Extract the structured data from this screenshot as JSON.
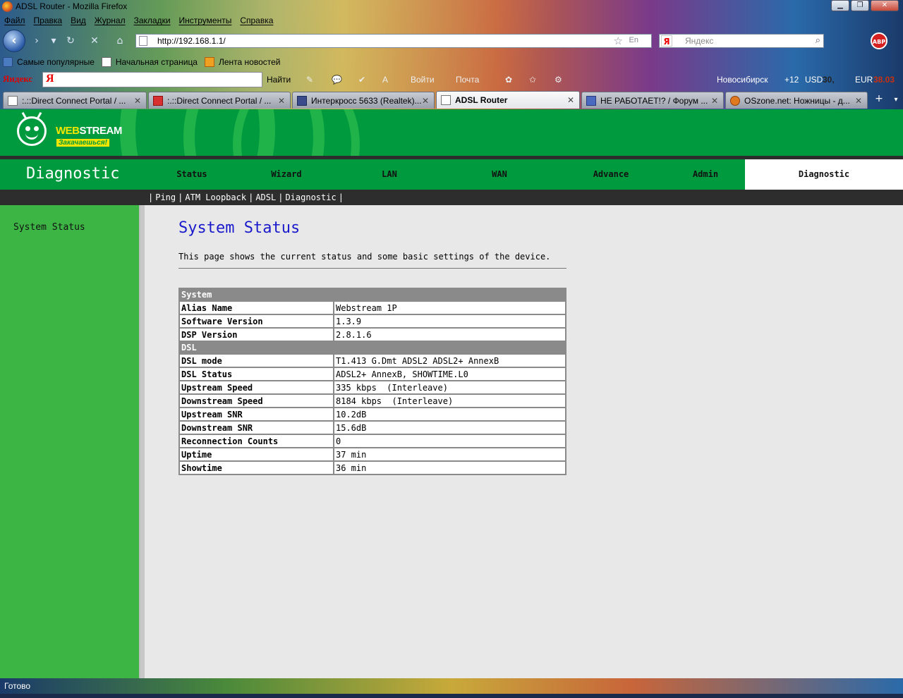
{
  "window": {
    "title": "ADSL Router - Mozilla Firefox"
  },
  "menubar": [
    "Файл",
    "Правка",
    "Вид",
    "Журнал",
    "Закладки",
    "Инструменты",
    "Справка"
  ],
  "navbar": {
    "url": "http://192.168.1.1/",
    "lang_indicator": "En",
    "search_placeholder": "Яндекс",
    "search_engine_letter": "Я",
    "abp_label": "ABP"
  },
  "bookmarks": [
    {
      "label": "Самые популярные",
      "icon": "popular-icon"
    },
    {
      "label": "Начальная страница",
      "icon": "page-icon"
    },
    {
      "label": "Лента новостей",
      "icon": "rss-icon"
    }
  ],
  "yandex_bar": {
    "logo": "Яндекс",
    "input_letter": "Я",
    "find_label": "Найти",
    "login_label": "Войти",
    "mail_label": "Почта",
    "city": "Новосибирск",
    "temperature": "+12",
    "usd_label": "USD",
    "usd_value": "30,",
    "eur_label": "EUR",
    "eur_value": "38.03"
  },
  "tabs": [
    {
      "label": ":.::Direct Connect Portal / ...",
      "icon": "page-icon",
      "active": false
    },
    {
      "label": ":.::Direct Connect Portal / ...",
      "icon": "dc-icon",
      "active": false
    },
    {
      "label": "Интеркросс 5633 (Realtek)...",
      "icon": "ik-icon",
      "active": false
    },
    {
      "label": "ADSL Router",
      "icon": "page-icon",
      "active": true
    },
    {
      "label": "НЕ РАБОТАЕТ!? / Форум ...",
      "icon": "forum-icon",
      "active": false
    },
    {
      "label": "OSzone.net: Ножницы - д...",
      "icon": "oszone-icon",
      "active": false
    }
  ],
  "router": {
    "brand": {
      "web": "WEB",
      "stream": "STREAM",
      "tagline": "Закачаешься!"
    },
    "section_title": "Diagnostic",
    "nav": [
      "Status",
      "Wizard",
      "LAN",
      "WAN",
      "Advance",
      "Admin",
      "Diagnostic"
    ],
    "active_nav": "Diagnostic",
    "subnav": [
      "Ping",
      "ATM Loopback",
      "ADSL",
      "Diagnostic"
    ],
    "sidebar": [
      "System Status"
    ],
    "heading": "System Status",
    "description": "This page shows the current status and some basic settings of the device.",
    "system_header": "System",
    "system_rows": [
      {
        "key": "Alias Name",
        "value": "Webstream 1P"
      },
      {
        "key": "Software Version",
        "value": "1.3.9"
      },
      {
        "key": "DSP Version",
        "value": "2.8.1.6"
      }
    ],
    "dsl_header": "DSL",
    "dsl_rows": [
      {
        "key": "DSL mode",
        "value": "T1.413 G.Dmt ADSL2 ADSL2+ AnnexB"
      },
      {
        "key": "DSL Status",
        "value": "ADSL2+ AnnexB, SHOWTIME.L0"
      },
      {
        "key": "Upstream Speed",
        "value": "335 kbps  (Interleave)"
      },
      {
        "key": "Downstream Speed",
        "value": "8184 kbps  (Interleave)"
      },
      {
        "key": "Upstream SNR",
        "value": "10.2dB"
      },
      {
        "key": "Downstream SNR",
        "value": "15.6dB"
      },
      {
        "key": "Reconnection Counts",
        "value": "0"
      },
      {
        "key": "Uptime",
        "value": "37 min"
      },
      {
        "key": "Showtime",
        "value": "36 min"
      }
    ]
  },
  "statusbar": {
    "text": "Готово"
  }
}
